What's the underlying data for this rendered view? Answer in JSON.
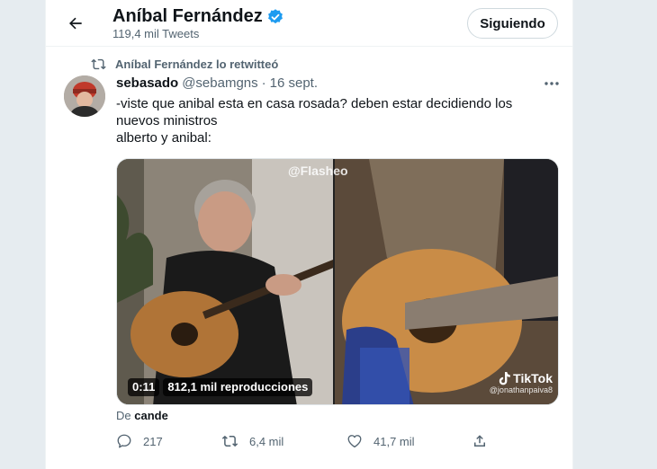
{
  "header": {
    "name": "Aníbal Fernández",
    "tweet_count": "119,4 mil Tweets",
    "follow_label": "Siguiendo",
    "back_icon": "arrow-left-icon",
    "verified_icon": "verified-badge-icon"
  },
  "retweet": {
    "label": "Aníbal Fernández lo retwitteó",
    "icon": "retweet-icon"
  },
  "tweet": {
    "author_name": "sebasado",
    "handle": "@sebamgns",
    "separator": "·",
    "date": "16 sept.",
    "text_line1": "-viste que anibal esta en casa rosada? deben estar decidiendo los nuevos ministros",
    "text_line2": "alberto y anibal:",
    "media": {
      "watermark_top": "@Flasheo",
      "duration": "0:11",
      "views": "812,1 mil reproducciones",
      "tiktok_label": "TikTok",
      "tiktok_handle": "@jonathanpaiva8"
    },
    "via_prefix": "De",
    "via_user": "cande",
    "stats": {
      "replies": "217",
      "retweets": "6,4 mil",
      "likes": "41,7 mil"
    }
  },
  "colors": {
    "accent": "#1d9bf0",
    "text": "#0f1419",
    "muted": "#536471",
    "background": "#e6ecf0"
  }
}
